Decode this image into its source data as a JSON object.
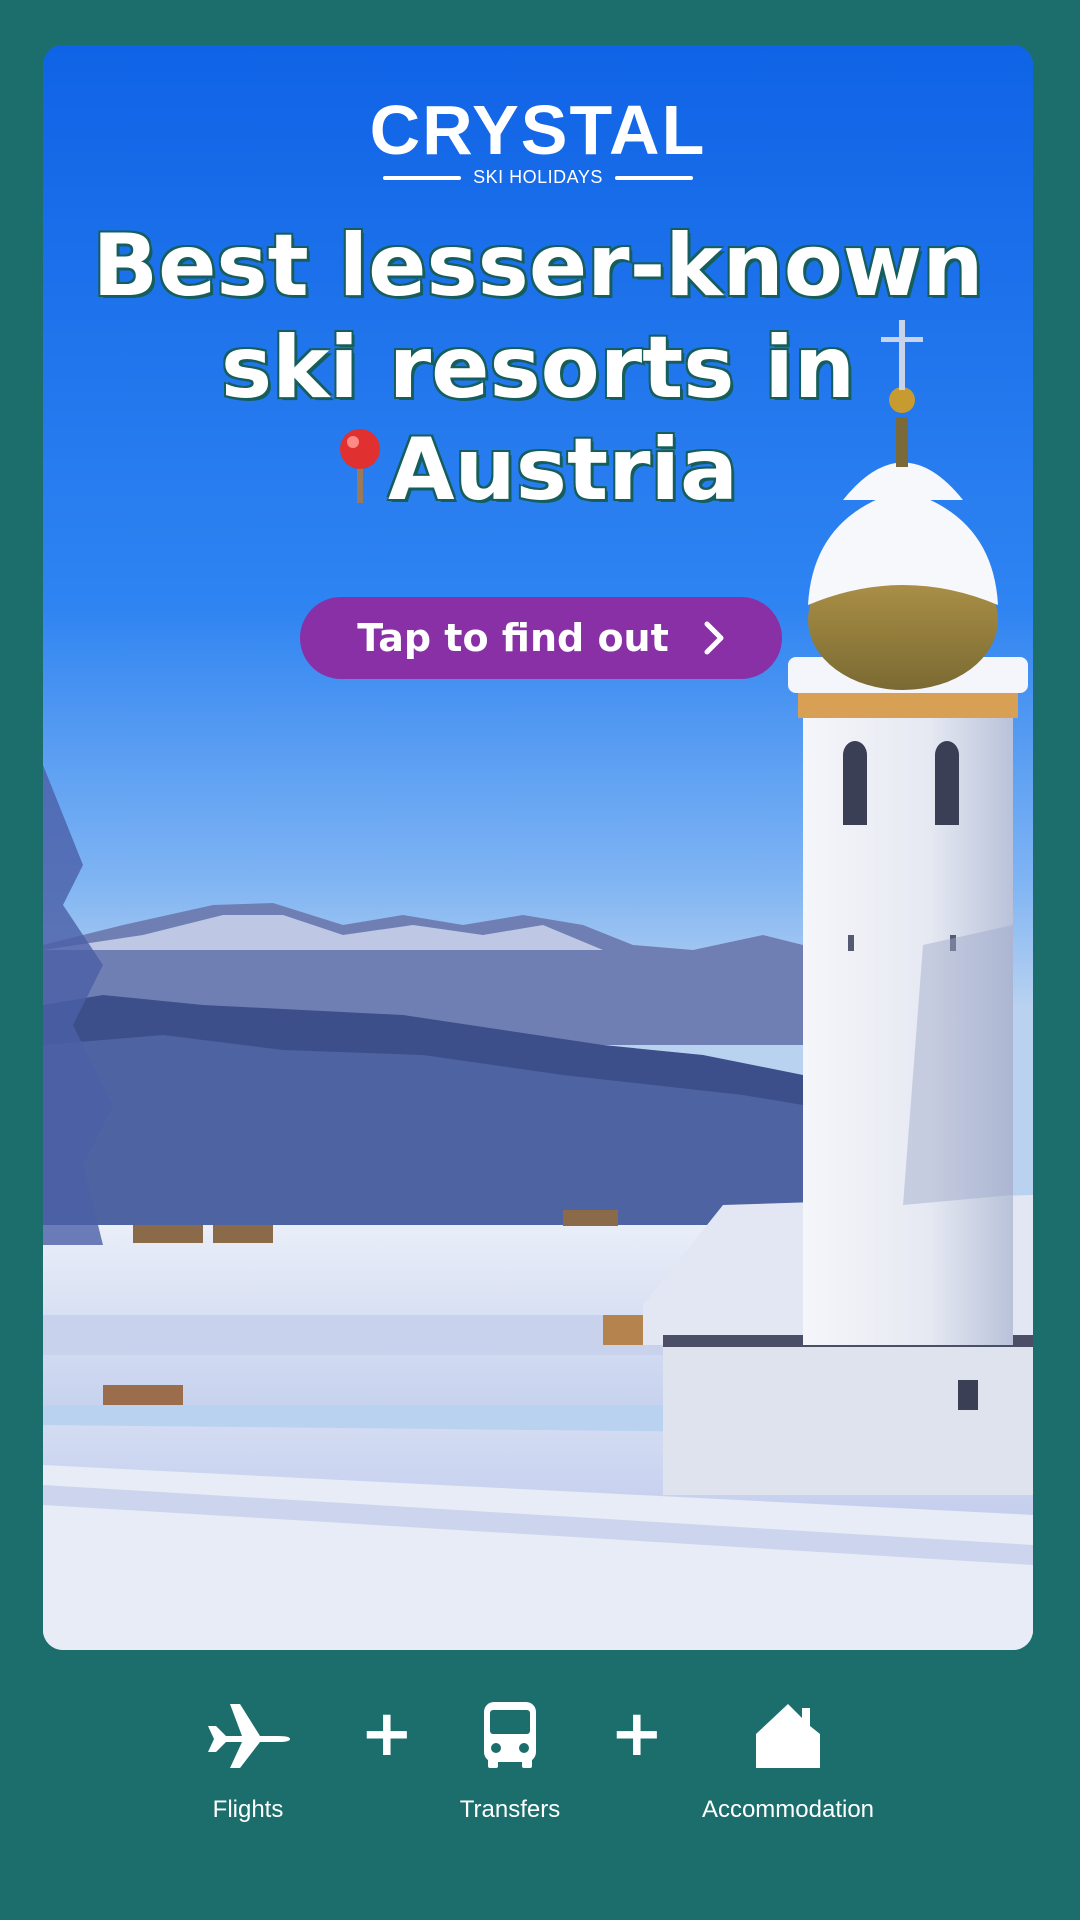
{
  "brand": {
    "name": "CRYSTAL",
    "tagline": "SKI HOLIDAYS"
  },
  "headline": {
    "line1": "Best lesser-known",
    "line2": "ski resorts in",
    "line3": "Austria"
  },
  "cta": {
    "label": "Tap to find out",
    "icon": "chevron-right-icon"
  },
  "features": [
    {
      "label": "Flights",
      "icon": "plane-icon"
    },
    {
      "label": "Transfers",
      "icon": "bus-icon"
    },
    {
      "label": "Accommodation",
      "icon": "house-icon"
    }
  ],
  "separator": "+",
  "colors": {
    "background": "#1b6e6c",
    "cta": "#8a30a6",
    "headline_outline": "#165e5b",
    "text": "#ffffff"
  }
}
